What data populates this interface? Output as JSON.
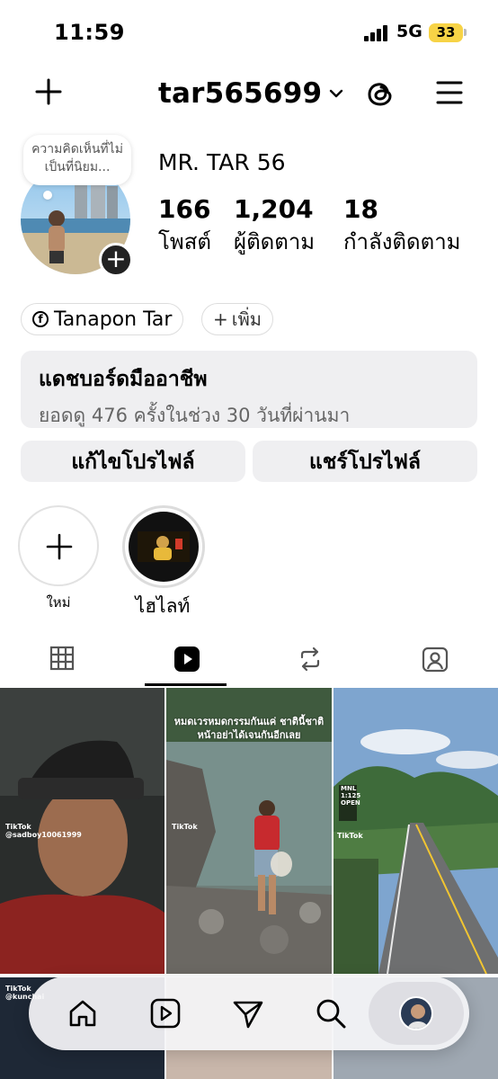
{
  "status": {
    "time": "11:59",
    "network": "5G",
    "battery": "33"
  },
  "header": {
    "username": "tar565699"
  },
  "profile": {
    "note": "ความคิดเห็นที่ไม่เป็นที่นิยม...",
    "display_name": "MR. TAR 56",
    "stats": [
      {
        "value": "166",
        "label": "โพสต์"
      },
      {
        "value": "1,204",
        "label": "ผู้ติดตาม"
      },
      {
        "value": "18",
        "label": "กำลังติดตาม"
      }
    ],
    "link_label": "Tanapon Tar",
    "add_label": "เพิ่ม"
  },
  "dashboard": {
    "title": "แดชบอร์ดมืออาชีพ",
    "subtitle": "ยอดดู 476 ครั้งในช่วง 30 วันที่ผ่านมา"
  },
  "buttons": {
    "edit_profile": "แก้ไขโปรไฟล์",
    "share_profile": "แชร์โปรไฟล์"
  },
  "highlights": {
    "new_label": "ใหม่",
    "highlight_label": "ไฮไลท์"
  },
  "tabs": [
    {
      "icon": "grid-icon"
    },
    {
      "icon": "reels-icon",
      "active": true
    },
    {
      "icon": "reposts-icon"
    },
    {
      "icon": "tagged-icon"
    }
  ],
  "posts": {
    "tiktok_label": "TikTok",
    "post1_handle": "@sadboy10061999",
    "post2_caption": "หมดเวรหมดกรรมกันแค่ ชาตินี้ชาติหน้าอย่าได้เจนกันอีกเลย",
    "post3_sign_mnl": "MNL",
    "post3_sign_time": "1:125",
    "post3_sign_open": "OPEN",
    "post4_handle": "@kunchai"
  },
  "nav": [
    "home-icon",
    "reels-icon",
    "send-icon",
    "search-icon",
    "profile-avatar"
  ],
  "colors": {
    "battery": "#f7d346",
    "surface": "#efeff1"
  }
}
